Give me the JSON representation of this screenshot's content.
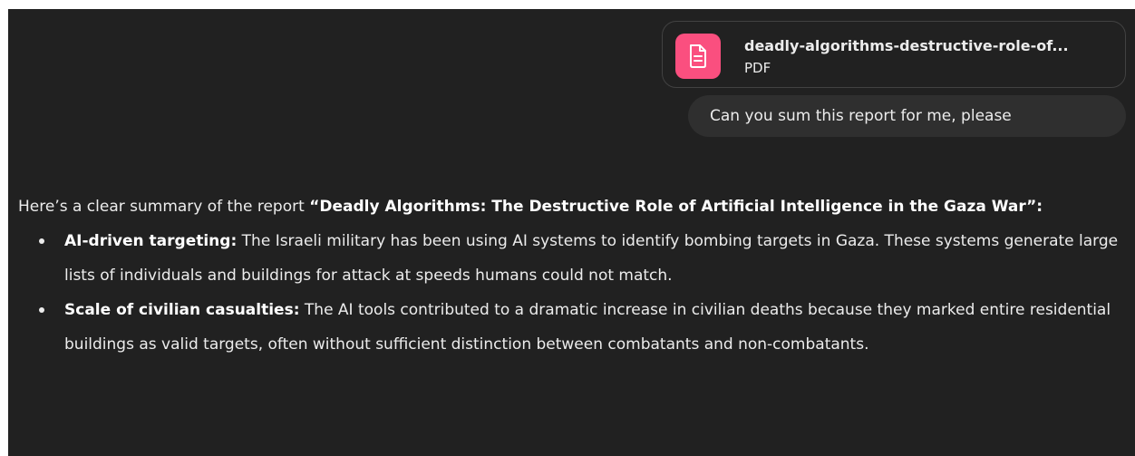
{
  "attachment": {
    "file_name": "deadly-algorithms-destructive-role-of...",
    "file_type": "PDF",
    "icon": "document-icon",
    "icon_color": "#fa4f7f"
  },
  "user_message": "Can you sum this report for me, please",
  "assistant": {
    "intro_prefix": "Here’s a clear summary of the report ",
    "intro_title": "“Deadly Algorithms: The Destructive Role of Artificial Intelligence in the Gaza War”",
    "intro_suffix": ":",
    "bullets": [
      {
        "label": "AI-driven targeting:",
        "text": " The Israeli military has been using AI systems to identify bombing targets in Gaza. These systems generate large lists of individuals and buildings for attack at speeds humans could not match."
      },
      {
        "label": "Scale of civilian casualties:",
        "text": " The AI tools contributed to a dramatic increase in civilian deaths because they marked entire residential buildings as valid targets, often without sufficient distinction between combatants and non-combatants."
      }
    ]
  },
  "colors": {
    "background": "#212121",
    "text": "#ececec",
    "bubble": "#2f2f2f",
    "card_border": "#424242"
  }
}
